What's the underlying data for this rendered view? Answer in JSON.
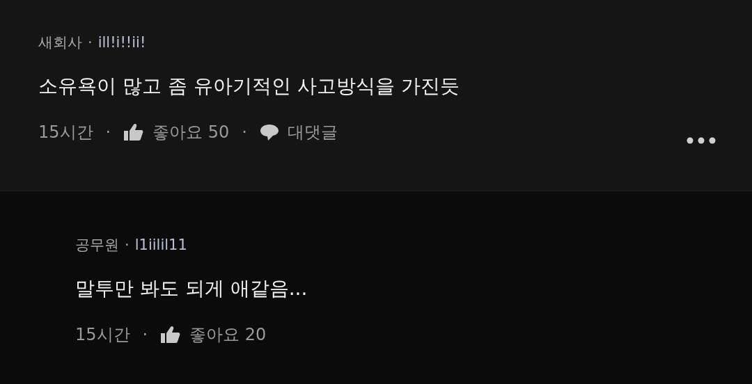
{
  "comments": [
    {
      "kind": "comment",
      "author": "새회사",
      "separator": "·",
      "handle": "ill!i!!ii!",
      "text": "소유욕이 많고 좀 유아기적인 사고방식을 가진듯",
      "time": "15시간",
      "meta_separator": "·",
      "likes": "좋아요 50",
      "reply_separator": "·",
      "reply_label": "대댓글",
      "has_menu": true
    },
    {
      "kind": "reply",
      "author": "공무원",
      "separator": "·",
      "handle": "l1iilil11",
      "text": "말투만 봐도 되게 애같음...",
      "time": "15시간",
      "meta_separator": "·",
      "likes": "좋아요 20",
      "has_menu": false
    }
  ]
}
